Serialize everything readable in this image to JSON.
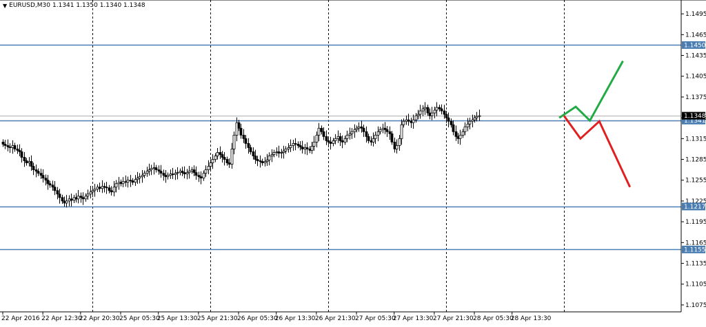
{
  "header": {
    "symbol": "EURUSD,M30",
    "ohlc": "1.1341 1.1350 1.1340 1.1348",
    "dropdown_icon": "triangle-down-icon"
  },
  "colors": {
    "background": "#ffffff",
    "axis": "#000000",
    "horizontal_line": "#4a7eb3",
    "candle": "#000000",
    "bullish_scenario": "#22aa44",
    "bearish_scenario": "#e02020",
    "price_tag_bg": "#4a7eb3",
    "current_price_tag_bg": "#000000",
    "vline": "#000000"
  },
  "chart_data": {
    "type": "candlestick",
    "symbol": "EURUSD",
    "timeframe": "M30",
    "ylim": [
      1.1065,
      1.1515
    ],
    "y_ticks": [
      "1.1495",
      "1.1465",
      "1.1435",
      "1.1405",
      "1.1375",
      "1.1345",
      "1.1315",
      "1.1285",
      "1.1255",
      "1.1225",
      "1.1195",
      "1.1165",
      "1.1135",
      "1.1105",
      "1.1075"
    ],
    "x_ticks": [
      "22 Apr 2016",
      "22 Apr 12:30",
      "22 Apr 20:30",
      "25 Apr 05:30",
      "25 Apr 13:30",
      "25 Apr 21:30",
      "26 Apr 05:30",
      "26 Apr 13:30",
      "26 Apr 21:30",
      "27 Apr 05:30",
      "27 Apr 13:30",
      "27 Apr 21:30",
      "28 Apr 05:30",
      "28 Apr 13:30"
    ],
    "x_tick_bar_index": [
      0,
      17,
      33,
      50,
      66,
      83,
      100,
      116,
      133,
      150,
      166,
      183,
      200,
      216
    ],
    "vertical_separators_bar_index": [
      38,
      88,
      138,
      188,
      238
    ],
    "horizontal_levels": [
      {
        "price": 1.145,
        "label": "1.1450"
      },
      {
        "price": 1.1341,
        "label": "1.1341"
      },
      {
        "price": 1.1217,
        "label": "1.1217"
      },
      {
        "price": 1.1155,
        "label": "1.1155"
      }
    ],
    "current_price": {
      "price": 1.1348,
      "label": "1.1348"
    },
    "closes": [
      1.1307,
      1.1305,
      1.1303,
      1.1302,
      1.1305,
      1.13,
      1.1298,
      1.1296,
      1.1288,
      1.1283,
      1.128,
      1.1282,
      1.1275,
      1.127,
      1.1268,
      1.1265,
      1.1262,
      1.1258,
      1.1255,
      1.125,
      1.1248,
      1.1245,
      1.124,
      1.1235,
      1.123,
      1.1225,
      1.1222,
      1.1225,
      1.1228,
      1.1226,
      1.123,
      1.1228,
      1.1232,
      1.123,
      1.1228,
      1.1232,
      1.1235,
      1.1238,
      1.124,
      1.1242,
      1.1245,
      1.1243,
      1.1246,
      1.1245,
      1.1244,
      1.124,
      1.1238,
      1.1245,
      1.125,
      1.1252,
      1.125,
      1.1253,
      1.1252,
      1.1255,
      1.1254,
      1.1252,
      1.1256,
      1.1258,
      1.126,
      1.1262,
      1.1265,
      1.1268,
      1.127,
      1.1272,
      1.1273,
      1.127,
      1.1268,
      1.1265,
      1.1262,
      1.126,
      1.1262,
      1.1264,
      1.1263,
      1.1265,
      1.1266,
      1.1268,
      1.1266,
      1.1264,
      1.1266,
      1.1268,
      1.127,
      1.1266,
      1.1262,
      1.126,
      1.1258,
      1.1265,
      1.127,
      1.1275,
      1.128,
      1.1285,
      1.129,
      1.1295,
      1.1292,
      1.1288,
      1.1285,
      1.128,
      1.1278,
      1.13,
      1.132,
      1.1338,
      1.133,
      1.132,
      1.1315,
      1.1308,
      1.1302,
      1.1296,
      1.129,
      1.1285,
      1.1283,
      1.1282,
      1.128,
      1.1282,
      1.1284,
      1.129,
      1.1292,
      1.1295,
      1.1296,
      1.1294,
      1.1295,
      1.1297,
      1.13,
      1.1302,
      1.1305,
      1.1308,
      1.1307,
      1.1305,
      1.1303,
      1.13,
      1.1302,
      1.13,
      1.1298,
      1.1304,
      1.131,
      1.132,
      1.133,
      1.1325,
      1.1318,
      1.1312,
      1.131,
      1.1308,
      1.1312,
      1.1315,
      1.1318,
      1.1312,
      1.131,
      1.1315,
      1.132,
      1.1322,
      1.1325,
      1.1328,
      1.133,
      1.1332,
      1.133,
      1.1325,
      1.1318,
      1.1312,
      1.131,
      1.1315,
      1.132,
      1.1325,
      1.1328,
      1.133,
      1.1328,
      1.1325,
      1.1322,
      1.131,
      1.13,
      1.1305,
      1.1315,
      1.1335,
      1.134,
      1.1342,
      1.134,
      1.1338,
      1.1342,
      1.1348,
      1.135,
      1.1355,
      1.1358,
      1.136,
      1.1352,
      1.1348,
      1.1352,
      1.1356,
      1.136,
      1.1358,
      1.1355,
      1.135,
      1.1345,
      1.134,
      1.1335,
      1.1325,
      1.1318,
      1.1315,
      1.132,
      1.1325,
      1.1332,
      1.1336,
      1.134,
      1.1342,
      1.1345,
      1.1347,
      1.1348
    ],
    "bullish_scenario_path": [
      [
        236,
        1.1345
      ],
      [
        243,
        1.1361
      ],
      [
        249,
        1.1341
      ],
      [
        263,
        1.1427
      ]
    ],
    "bearish_scenario_path": [
      [
        238,
        1.1348
      ],
      [
        245,
        1.1315
      ],
      [
        253,
        1.134
      ],
      [
        266,
        1.1245
      ]
    ]
  }
}
